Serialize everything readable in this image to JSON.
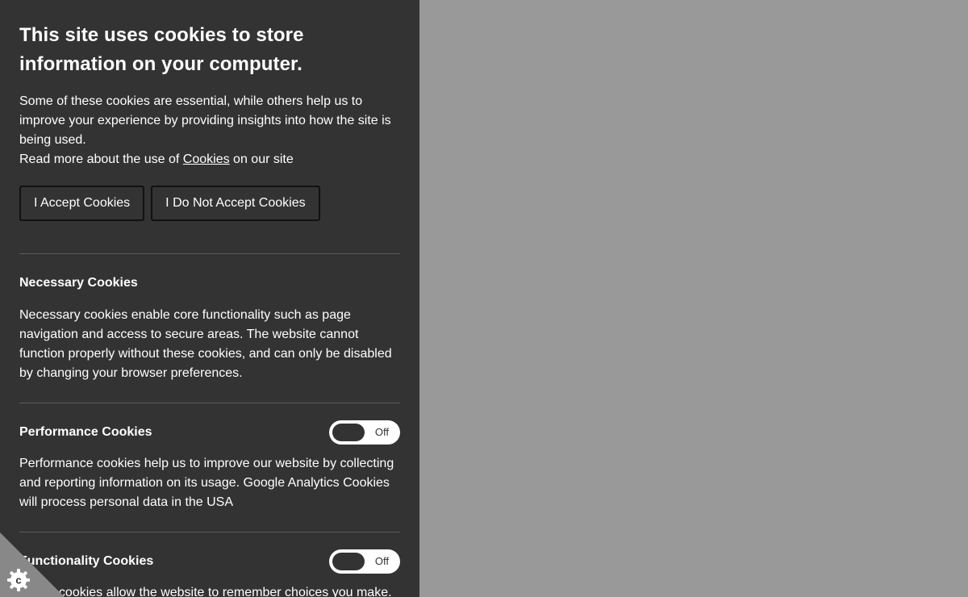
{
  "banner": {
    "title": "This site uses cookies to store information on your computer.",
    "intro_text": "Some of these cookies are essential, while others help us to improve your experience by providing insights into how the site is being used.",
    "readmore_prefix": "Read more about the use of ",
    "readmore_link": "Cookies",
    "readmore_suffix": " on our site",
    "accept_label": "I Accept Cookies",
    "decline_label": "I Do Not Accept Cookies"
  },
  "sections": [
    {
      "title": "Necessary Cookies",
      "description": "Necessary cookies enable core functionality such as page navigation and access to secure areas. The website cannot function properly without these cookies, and can only be disabled by changing your browser preferences."
    },
    {
      "title": "Performance Cookies",
      "description": "Performance cookies help us to improve our website by collecting and reporting information on its usage. Google Analytics Cookies will process personal data in the USA",
      "toggle_label": "Off"
    },
    {
      "title": "Functionality Cookies",
      "description": "These cookies allow the website to remember choices you make.",
      "toggle_label": "Off"
    }
  ],
  "colors": {
    "panel_background": "#333333",
    "page_background": "#999999",
    "text": "#ffffff"
  },
  "icons": {
    "settings_corner": "cookie-settings-icon"
  }
}
